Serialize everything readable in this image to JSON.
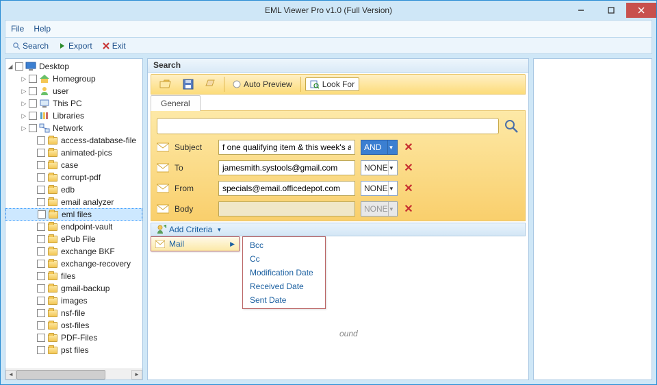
{
  "title": "EML Viewer Pro v1.0 (Full Version)",
  "menu": {
    "file": "File",
    "help": "Help"
  },
  "toolbar": {
    "search": "Search",
    "export": "Export",
    "exit": "Exit"
  },
  "tree": {
    "root": "Desktop",
    "items": [
      "Homegroup",
      "user",
      "This PC",
      "Libraries",
      "Network",
      "access-database-file",
      "animated-pics",
      "case",
      "corrupt-pdf",
      "edb",
      "email analyzer",
      "eml files",
      "endpoint-vault",
      "ePub File",
      "exchange BKF",
      "exchange-recovery",
      "files",
      "gmail-backup",
      "images",
      "nsf-file",
      "ost-files",
      "PDF-Files",
      "pst files"
    ],
    "selected": "eml files"
  },
  "search": {
    "header": "Search",
    "autoPreview": "Auto Preview",
    "lookFor": "Look For",
    "tab": "General",
    "criteria": [
      {
        "label": "Subject",
        "value": "f one qualifying item & this week's ad",
        "op": "AND",
        "opClass": "and"
      },
      {
        "label": "To",
        "value": "jamesmith.systools@gmail.com",
        "op": "NONE",
        "opClass": ""
      },
      {
        "label": "From",
        "value": "specials@email.officedepot.com",
        "op": "NONE",
        "opClass": ""
      },
      {
        "label": "Body",
        "value": "",
        "op": "NONE",
        "opClass": "disabled",
        "disabled": true
      }
    ],
    "addCriteria": "Add Criteria",
    "popupCategory": "Mail",
    "popupItems": [
      "Bcc",
      "Cc",
      "Modification Date",
      "Received Date",
      "Sent Date"
    ],
    "belowText": "ound"
  }
}
